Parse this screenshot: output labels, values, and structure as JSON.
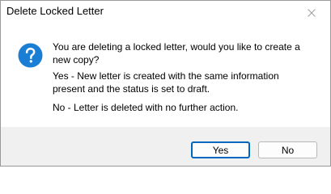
{
  "window": {
    "title": "Delete Locked Letter"
  },
  "message": {
    "icon": "question-icon",
    "line1": "You are deleting a locked letter, would you like to create a new copy?",
    "line2": "Yes - New letter is created with the same information present and the status is set to draft.",
    "line3": "No - Letter is deleted with no further action."
  },
  "buttons": {
    "yes_label": "Yes",
    "no_label": "No"
  },
  "colors": {
    "accent": "#0067c0",
    "icon_fill": "#1a7fd4"
  }
}
